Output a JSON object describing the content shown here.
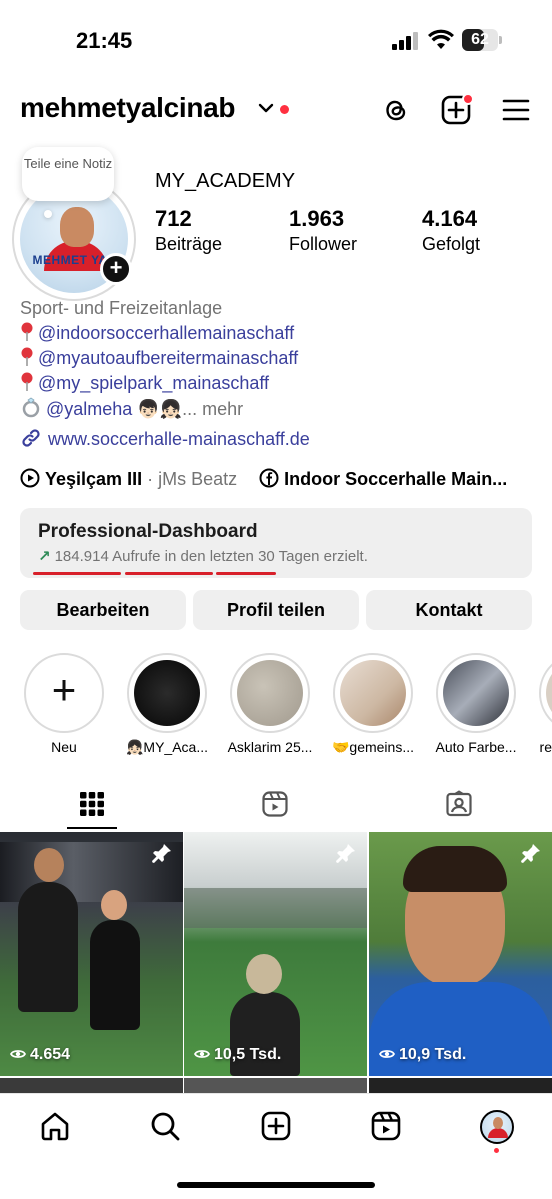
{
  "status_bar": {
    "time": "21:45",
    "battery": "62",
    "battery_level": 0.62
  },
  "header": {
    "username": "mehmetyalcinab",
    "has_notification_dot": true
  },
  "note": {
    "text": "Teile eine Notiz"
  },
  "profile": {
    "avatar_caption": "MEHMET YAL",
    "display_name": "MY_ACADEMY",
    "stats": [
      {
        "value": "712",
        "label": "Beiträge"
      },
      {
        "value": "1.963",
        "label": "Follower"
      },
      {
        "value": "4.164",
        "label": "Gefolgt"
      }
    ],
    "bio": {
      "category": "Sport- und Freizeitanlage",
      "mentions": [
        "@indoorsoccerhallemainaschaff",
        "@myautoaufbereitermainaschaff",
        "@my_spielpark_mainaschaff"
      ],
      "ring_mention": "@yalmeha",
      "ring_emoji": "👦🏻👧🏻",
      "more": "... mehr",
      "link": "www.soccerhalle-mainaschaff.de"
    },
    "music": {
      "song": "Yeşilçam III",
      "separator": " · ",
      "artist": "jMs Beatz",
      "page": "Indoor Soccerhalle Main..."
    }
  },
  "dashboard": {
    "title": "Professional-Dashboard",
    "arrow": "↗",
    "subtitle": "184.914 Aufrufe in den letzten 30 Tagen erzielt."
  },
  "buttons": {
    "edit": "Bearbeiten",
    "share": "Profil teilen",
    "contact": "Kontakt"
  },
  "highlights": [
    {
      "label": "Neu"
    },
    {
      "label": "👧🏻MY_Aca..."
    },
    {
      "label": "Asklarim 25..."
    },
    {
      "label": "🤝gemeins..."
    },
    {
      "label": "Auto Farbe..."
    },
    {
      "label": "Fre"
    }
  ],
  "posts": [
    {
      "views": "4.654",
      "pinned": true
    },
    {
      "views": "10,5 Tsd.",
      "pinned": true
    },
    {
      "views": "10,9 Tsd.",
      "pinned": true
    }
  ],
  "colors": {
    "accent_red": "#ff3040",
    "link_blue": "#3a3f9c",
    "muted": "#737373",
    "button_bg": "#efefef"
  }
}
